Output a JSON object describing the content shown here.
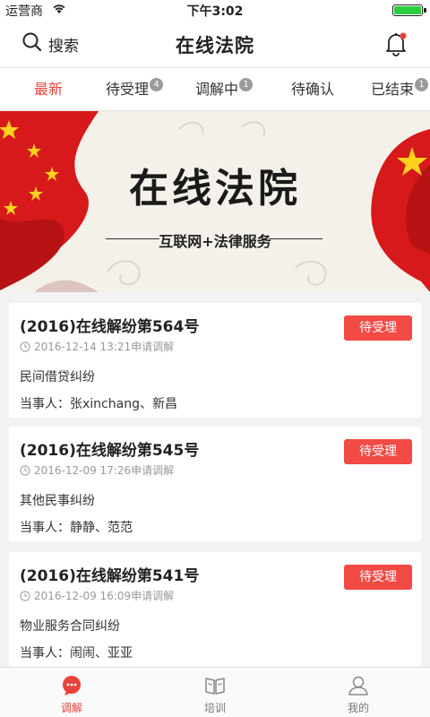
{
  "status_bar": {
    "carrier": "运营商",
    "time": "下午3:02"
  },
  "nav": {
    "search_label": "搜索",
    "title": "在线法院"
  },
  "tabs": [
    {
      "label": "最新",
      "badge": ""
    },
    {
      "label": "待受理",
      "badge": "4"
    },
    {
      "label": "调解中",
      "badge": "1"
    },
    {
      "label": "待确认",
      "badge": ""
    },
    {
      "label": "已结束",
      "badge": "1"
    }
  ],
  "banner": {
    "title": "在线法院",
    "subtitle": "互联网+法律服务"
  },
  "cases": [
    {
      "number": "(2016)在线解纷第564号",
      "time": "2016-12-14 13:21申请调解",
      "type": "民间借贷纠纷",
      "parties": "当事人：张xinchang、新昌",
      "status": "待受理"
    },
    {
      "number": "(2016)在线解纷第545号",
      "time": "2016-12-09 17:26申请调解",
      "type": "其他民事纠纷",
      "parties": "当事人：静静、范范",
      "status": "待受理"
    },
    {
      "number": "(2016)在线解纷第541号",
      "time": "2016-12-09 16:09申请调解",
      "type": "物业服务合同纠纷",
      "parties": "当事人：闹闹、亚亚",
      "status": "待受理"
    }
  ],
  "bottom_tabs": [
    {
      "label": "调解",
      "icon": "chat-bubble-icon"
    },
    {
      "label": "培训",
      "icon": "book-icon"
    },
    {
      "label": "我的",
      "icon": "user-icon"
    }
  ],
  "colors": {
    "accent": "#e8433a",
    "status_button": "#f24a45",
    "badge": "#9a9a9a"
  }
}
